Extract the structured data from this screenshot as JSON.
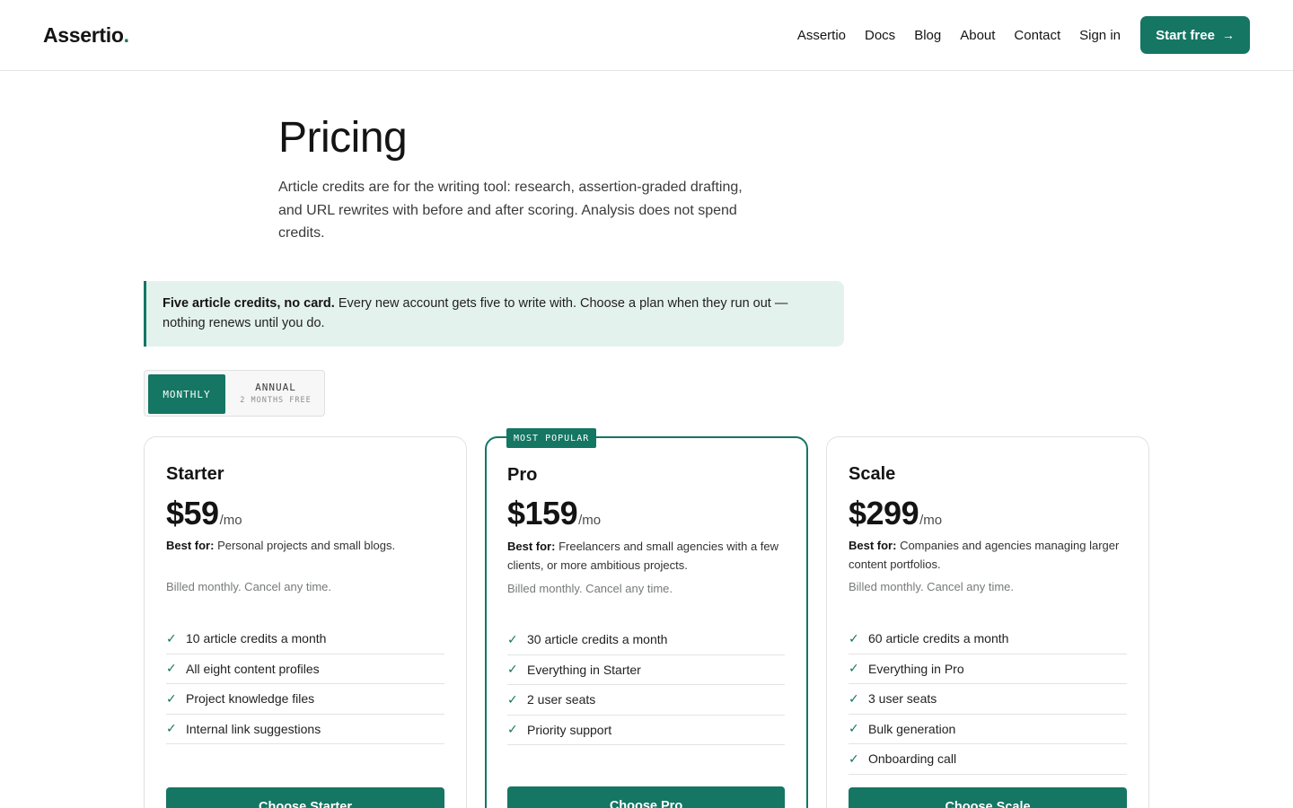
{
  "brand": {
    "name": "Assertio",
    "dot": "."
  },
  "nav": {
    "items": [
      "Assertio",
      "Docs",
      "Blog",
      "About",
      "Contact",
      "Sign in"
    ],
    "cta_label": "Start free",
    "cta_arrow": "→"
  },
  "hero": {
    "title": "Pricing",
    "lead": "Article credits are for the writing tool: research, assertion-graded drafting, and URL rewrites with before and after scoring. Analysis does not spend credits."
  },
  "notice": {
    "bold": "Five article credits, no card.",
    "text": " Every new account gets five to write with. Choose a plan when they run out — nothing renews until you do."
  },
  "billing_toggle": {
    "monthly_label": "MONTHLY",
    "annual_label": "ANNUAL",
    "annual_sub": "2 MONTHS FREE",
    "selected": "monthly"
  },
  "colors": {
    "accent": "#147663",
    "notice_bg": "#e4f2ed"
  },
  "plans": [
    {
      "name": "Starter",
      "price": "$59",
      "per": "/mo",
      "best_for_label": "Best for:",
      "best_for": " Personal projects and small blogs.",
      "billing": "Billed monthly. Cancel any time.",
      "features": [
        "10 article credits a month",
        "All eight content profiles",
        "Project knowledge files",
        "Internal link suggestions"
      ],
      "button": "Choose Starter"
    },
    {
      "name": "Pro",
      "badge": "MOST POPULAR",
      "price": "$159",
      "per": "/mo",
      "best_for_label": "Best for:",
      "best_for": " Freelancers and small agencies with a few clients, or more ambitious projects.",
      "billing": "Billed monthly. Cancel any time.",
      "features": [
        "30 article credits a month",
        "Everything in Starter",
        "2 user seats",
        "Priority support"
      ],
      "button": "Choose Pro"
    },
    {
      "name": "Scale",
      "price": "$299",
      "per": "/mo",
      "best_for_label": "Best for:",
      "best_for": " Companies and agencies managing larger content portfolios.",
      "billing": "Billed monthly. Cancel any time.",
      "features": [
        "60 article credits a month",
        "Everything in Pro",
        "3 user seats",
        "Bulk generation",
        "Onboarding call"
      ],
      "button": "Choose Scale"
    }
  ]
}
